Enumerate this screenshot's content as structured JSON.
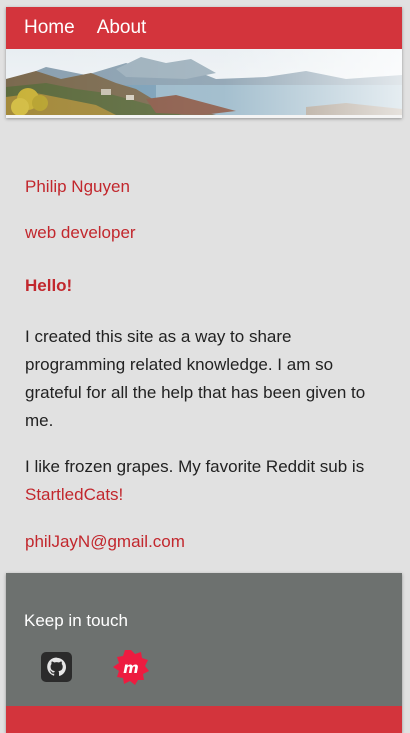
{
  "nav": {
    "links": [
      "Home",
      "About"
    ]
  },
  "profile": {
    "name": "Philip Nguyen",
    "role": "web developer",
    "greeting": "Hello!",
    "paragraph_1": "I created this site as a way to share programming related knowledge. I am so grateful for all the help that has been given to me.",
    "paragraph_2_prefix": "I like frozen grapes. My favorite Reddit sub is ",
    "paragraph_2_link": "StartledCats!",
    "email": "philJayN@gmail.com"
  },
  "footer": {
    "title": "Keep in touch",
    "icons": [
      "github-icon",
      "meetup-icon"
    ]
  },
  "colors": {
    "brand": "#d3343c",
    "accent_text": "#c2272d",
    "footer_bg": "#6d716f",
    "page_bg": "#e1e1e1"
  }
}
